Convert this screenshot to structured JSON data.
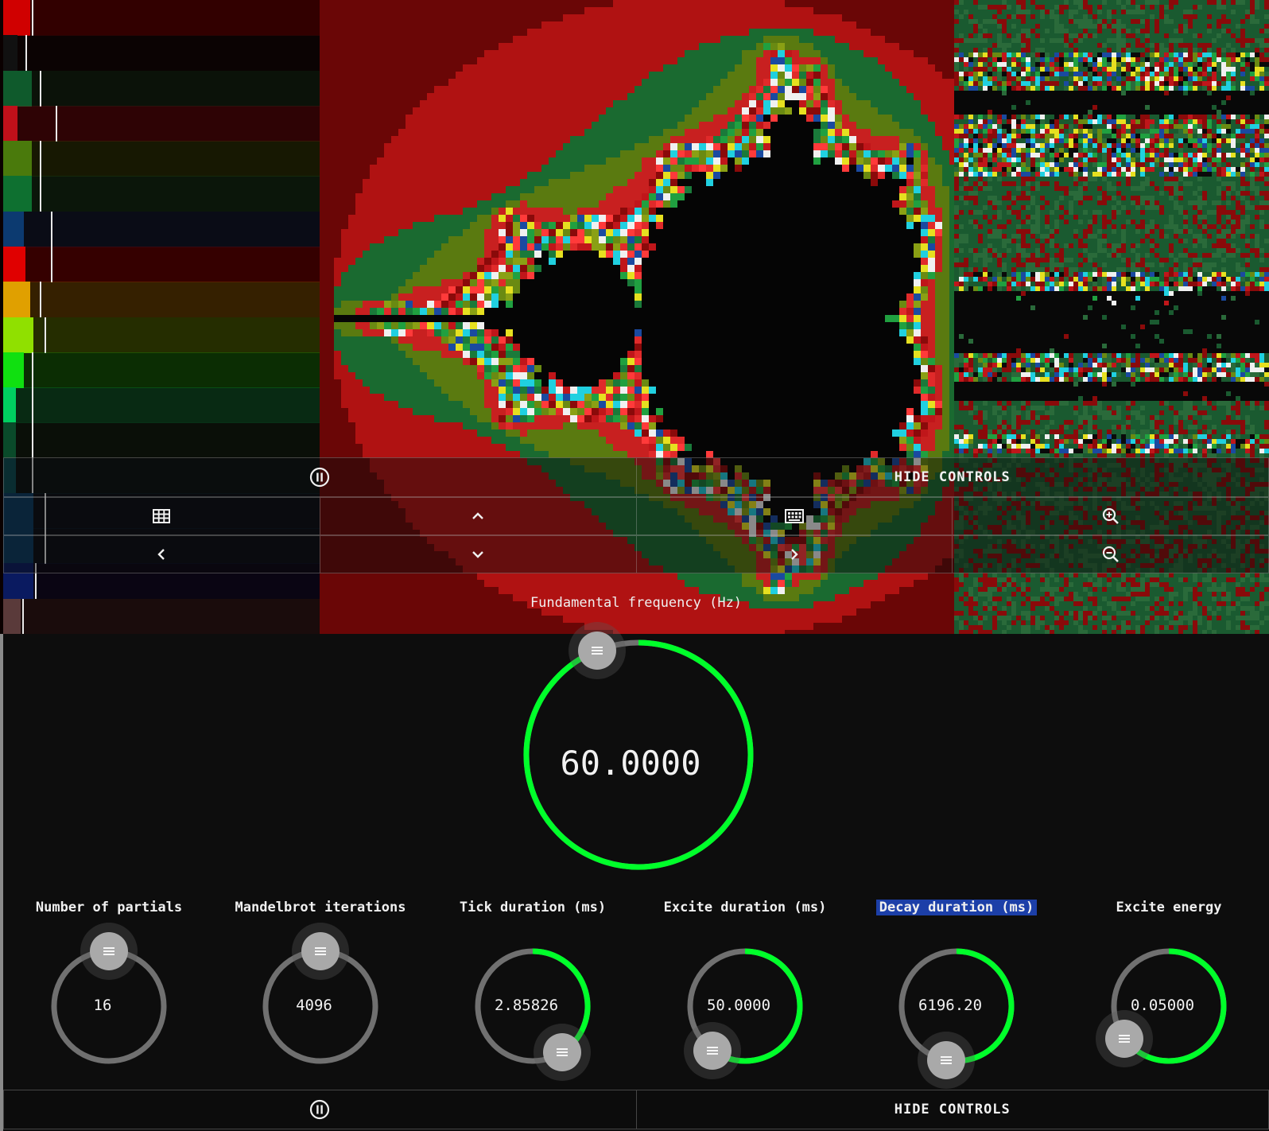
{
  "left_bar_colors": [
    "#d00000",
    "#111111",
    "#0f5a2c",
    "#c0101a",
    "#4a7a0c",
    "#0e7030",
    "#0c3a70",
    "#e00000",
    "#e0a000",
    "#90e000",
    "#10e010",
    "#00d060",
    "#0a4a2a",
    "#0a4a50",
    "#0a3a60",
    "#0a3a60",
    "#0a1a60",
    "#5a3a3a"
  ],
  "controls_top": {
    "pause_icon": "pause-circle-icon",
    "hide_label": "HIDE CONTROLS",
    "row2_icons": [
      "grid-icon",
      "chevron-up-icon",
      "keyboard-icon",
      "zoom-in-icon"
    ],
    "row3_icons": [
      "chevron-left-icon",
      "chevron-down-icon",
      "chevron-right-icon",
      "zoom-out-icon"
    ],
    "fundamental_label": "Fundamental frequency (Hz)"
  },
  "main_knob": {
    "value": "60.0000",
    "fraction": 0.94,
    "accent": "#00ff2a"
  },
  "knobs": [
    {
      "label": "Number of partials",
      "value": "16",
      "fraction": 1.0
    },
    {
      "label": "Mandelbrot iterations",
      "value": "4096",
      "fraction": 1.0
    },
    {
      "label": "Tick duration (ms)",
      "value": "2.85826",
      "fraction": 0.41
    },
    {
      "label": "Excite duration (ms)",
      "value": "50.0000",
      "fraction": 0.6
    },
    {
      "label": "Decay duration (ms)",
      "value": "6196.20",
      "fraction": 0.53
    },
    {
      "label": "Excite energy",
      "value": "0.05000",
      "fraction": 0.65
    }
  ],
  "controls_bottom": {
    "pause_icon": "pause-circle-icon",
    "hide_label": "HIDE CONTROLS"
  },
  "colors": {
    "accent": "#00ff2a",
    "track": "#707070",
    "background": "#0d0d0d"
  }
}
